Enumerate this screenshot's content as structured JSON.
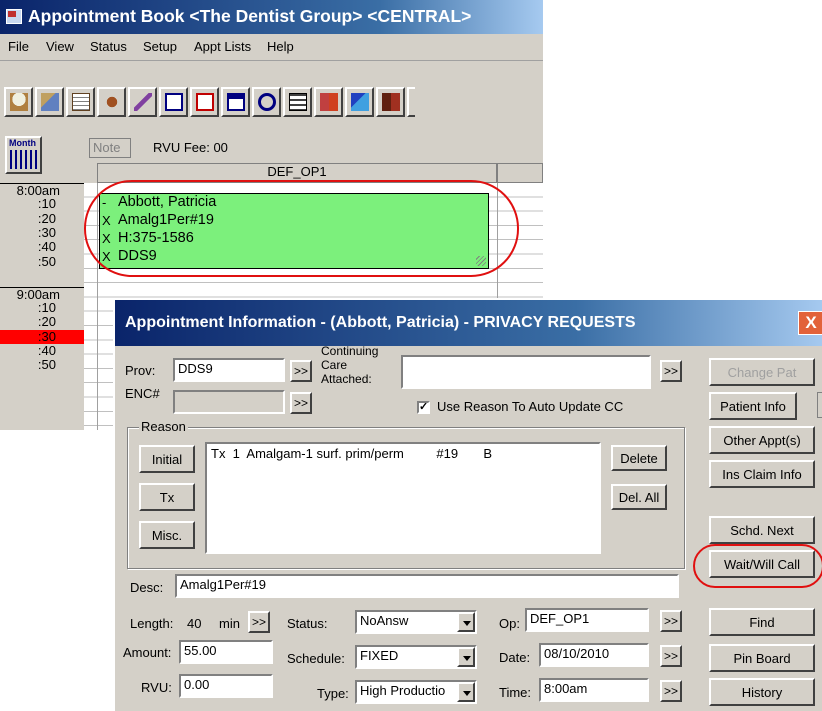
{
  "apptbook": {
    "title": "Appointment Book <The Dentist Group> <CENTRAL>",
    "menu": [
      "File",
      "View",
      "Status",
      "Setup",
      "Appt Lists",
      "Help"
    ],
    "month_label": "Month",
    "note_label": "Note",
    "rvu_fee": "RVU Fee: 00",
    "column_header": "DEF_OP1",
    "times": [
      "8:00am",
      ":10",
      ":20",
      ":30",
      ":40",
      ":50",
      "9:00am",
      ":10",
      ":20",
      ":30",
      ":40",
      ":50"
    ],
    "current_time_index": 9,
    "appointment": {
      "lines": [
        "Abbott, Patricia",
        "Amalg1Per#19",
        "H:375-1586",
        "DDS9"
      ],
      "marks": [
        "-",
        "X",
        "X",
        "X"
      ],
      "color": "#7cf07c"
    }
  },
  "dialog": {
    "title": "Appointment Information - (Abbott, Patricia) - PRIVACY REQUESTS",
    "close": "X",
    "prov_label": "Prov:",
    "prov_value": "DDS9",
    "enc_label": "ENC#",
    "enc_value": "",
    "cc_label_1": "Continuing",
    "cc_label_2": "Care",
    "cc_label_3": "Attached:",
    "cc_value": "",
    "arrow": ">>",
    "use_reason_label": "Use Reason To Auto Update CC",
    "use_reason_checked": true,
    "checkbox_mark": "✓",
    "reason_label": "Reason",
    "reason_buttons": [
      "Initial",
      "Tx",
      "Misc."
    ],
    "reason_items": [
      "Tx  1  Amalgam-1 surf. prim/perm         #19       B"
    ],
    "delete_label": "Delete",
    "del_all_label": "Del. All",
    "desc_label": "Desc:",
    "desc_value": "Amalg1Per#19",
    "length_label": "Length:",
    "length_value": "40",
    "length_unit": "min",
    "amount_label": "Amount:",
    "amount_value": "55.00",
    "rvu_label": "RVU:",
    "rvu_value": "0.00",
    "status_label": "Status:",
    "status_value": "NoAnsw",
    "schedule_label": "Schedule:",
    "schedule_value": "FIXED",
    "type_label": "Type:",
    "type_value": "High Productio",
    "op_label": "Op:",
    "op_value": "DEF_OP1",
    "date_label": "Date:",
    "date_value": "08/10/2010",
    "time_label": "Time:",
    "time_value": "8:00am",
    "right_buttons": {
      "change_pat": "Change Pat",
      "patient_info": "Patient Info",
      "other_appts": "Other Appt(s)",
      "ins_claim": "Ins Claim Info",
      "schd_next": "Schd. Next",
      "wait_will_call": "Wait/Will Call",
      "find": "Find",
      "pin_board": "Pin Board",
      "history": "History"
    }
  },
  "colors": {
    "title_bar": "#0a246a",
    "highlight_oval": "#e01010",
    "current_time": "#ff0000",
    "window_bg": "#d4d0c8"
  }
}
